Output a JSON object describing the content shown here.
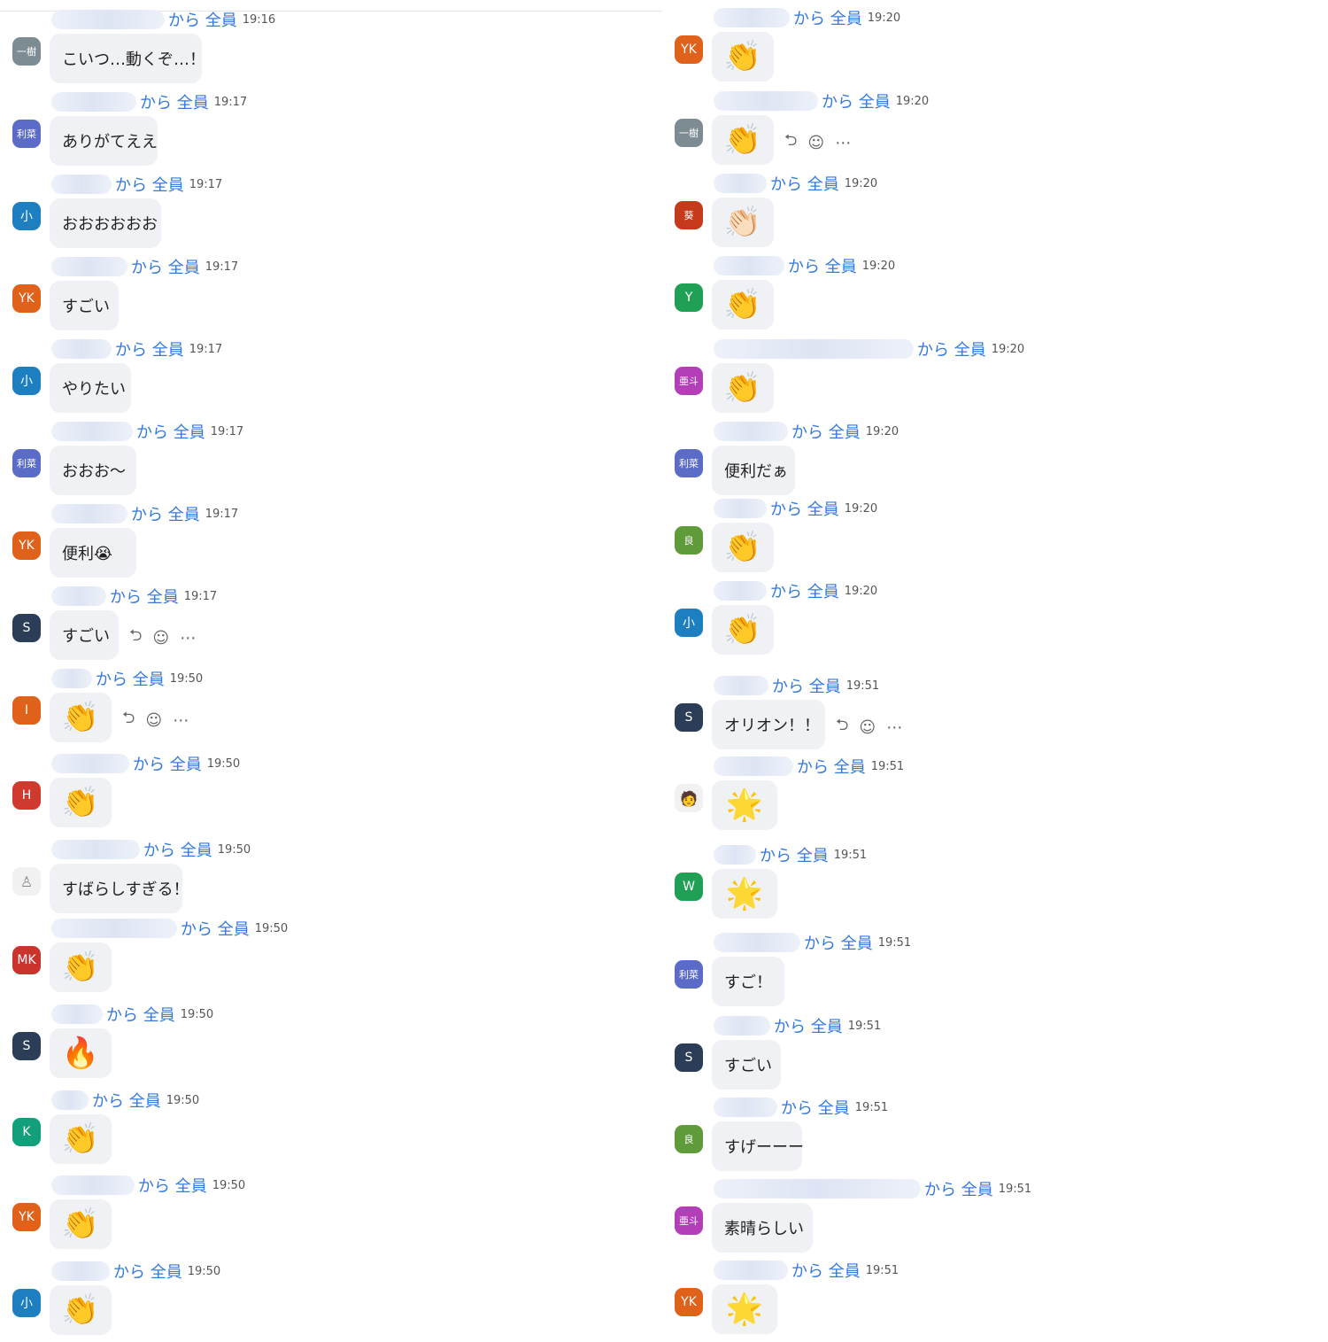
{
  "from_label": "から",
  "to_label": "全員",
  "left": [
    {
      "avatar": "一樹",
      "avatar_color": "#7d8b93",
      "avatar_small": true,
      "time": "19:16",
      "text": "こいつ…動くぞ…！",
      "emoji": false
    },
    {
      "avatar": "利菜",
      "avatar_color": "#5b6bc8",
      "avatar_small": true,
      "time": "19:17",
      "text": "ありがてええ",
      "emoji": false
    },
    {
      "avatar": "小",
      "avatar_color": "#1e7fc0",
      "time": "19:17",
      "text": "おおおおおお",
      "emoji": false
    },
    {
      "avatar": "YK",
      "avatar_color": "#e0611a",
      "time": "19:17",
      "text": "すごい",
      "emoji": false
    },
    {
      "avatar": "小",
      "avatar_color": "#1e7fc0",
      "time": "19:17",
      "text": "やりたい",
      "emoji": false
    },
    {
      "avatar": "利菜",
      "avatar_color": "#5b6bc8",
      "avatar_small": true,
      "time": "19:17",
      "text": "おおお〜",
      "emoji": false
    },
    {
      "avatar": "YK",
      "avatar_color": "#e0611a",
      "time": "19:17",
      "text": "便利😭",
      "emoji": false
    },
    {
      "avatar": "S",
      "avatar_color": "#2c3e57",
      "time": "19:17",
      "text": "すごい",
      "emoji": false,
      "actions": true
    },
    {
      "avatar": "I",
      "avatar_color": "#e0611a",
      "time": "19:50",
      "text": "👏",
      "emoji": true,
      "actions": true
    },
    {
      "avatar": "H",
      "avatar_color": "#d03a2e",
      "time": "19:50",
      "text": "👏",
      "emoji": true
    },
    {
      "avatar": "♙",
      "avatar_color": "#f1f1f1",
      "avatar_img": true,
      "time": "19:50",
      "text": "すばらしすぎる！",
      "emoji": false
    },
    {
      "avatar": "MK",
      "avatar_color": "#c9352d",
      "time": "19:50",
      "text": "👏",
      "emoji": true
    },
    {
      "avatar": "S",
      "avatar_color": "#2c3e57",
      "time": "19:50",
      "text": "🔥",
      "emoji": true
    },
    {
      "avatar": "K",
      "avatar_color": "#12a07a",
      "time": "19:50",
      "text": "👏",
      "emoji": true
    },
    {
      "avatar": "YK",
      "avatar_color": "#e0611a",
      "time": "19:50",
      "text": "👏",
      "emoji": true
    },
    {
      "avatar": "小",
      "avatar_color": "#1e7fc0",
      "time": "19:50",
      "text": "👏",
      "emoji": true
    }
  ],
  "right": [
    {
      "avatar": "YK",
      "avatar_color": "#e0611a",
      "time": "19:20",
      "text": "👏",
      "emoji": true
    },
    {
      "avatar": "一樹",
      "avatar_color": "#7d8b93",
      "avatar_small": true,
      "time": "19:20",
      "text": "👏",
      "emoji": true,
      "actions": true
    },
    {
      "avatar": "葵",
      "avatar_color": "#c53a1b",
      "avatar_small": true,
      "time": "19:20",
      "text": "👏🏻",
      "emoji": true
    },
    {
      "avatar": "Y",
      "avatar_color": "#1fa055",
      "time": "19:20",
      "text": "👏",
      "emoji": true
    },
    {
      "avatar": "亜斗",
      "avatar_color": "#b23fb8",
      "avatar_small": true,
      "time": "19:20",
      "text": "👏",
      "emoji": true
    },
    {
      "avatar": "利菜",
      "avatar_color": "#5b6bc8",
      "avatar_small": true,
      "time": "19:20",
      "text": "便利だぁ",
      "emoji": false
    },
    {
      "avatar": "良",
      "avatar_color": "#5f9b3a",
      "avatar_small": true,
      "time": "19:20",
      "text": "👏",
      "emoji": true
    },
    {
      "avatar": "小",
      "avatar_color": "#1e7fc0",
      "time": "19:20",
      "text": "👏",
      "emoji": true
    },
    {
      "avatar": "S",
      "avatar_color": "#2c3e57",
      "time": "19:51",
      "text": "オリオン！！",
      "emoji": false,
      "actions": true
    },
    {
      "avatar": "🧑",
      "avatar_color": "#f1f1f1",
      "avatar_img": true,
      "time": "19:51",
      "text": "🌟",
      "emoji": true
    },
    {
      "avatar": "W",
      "avatar_color": "#1fa055",
      "time": "19:51",
      "text": "🌟",
      "emoji": true
    },
    {
      "avatar": "利菜",
      "avatar_color": "#5b6bc8",
      "avatar_small": true,
      "time": "19:51",
      "text": "すご！",
      "emoji": false
    },
    {
      "avatar": "S",
      "avatar_color": "#2c3e57",
      "time": "19:51",
      "text": "すごい",
      "emoji": false
    },
    {
      "avatar": "良",
      "avatar_color": "#5f9b3a",
      "avatar_small": true,
      "time": "19:51",
      "text": "すげーーー",
      "emoji": false
    },
    {
      "avatar": "亜斗",
      "avatar_color": "#b23fb8",
      "avatar_small": true,
      "time": "19:51",
      "text": "素晴らしい",
      "emoji": false
    },
    {
      "avatar": "YK",
      "avatar_color": "#e0611a",
      "time": "19:51",
      "text": "🌟",
      "emoji": true
    }
  ],
  "action_icons": {
    "reply": "⮌",
    "react": "☺",
    "more": "⋯"
  }
}
